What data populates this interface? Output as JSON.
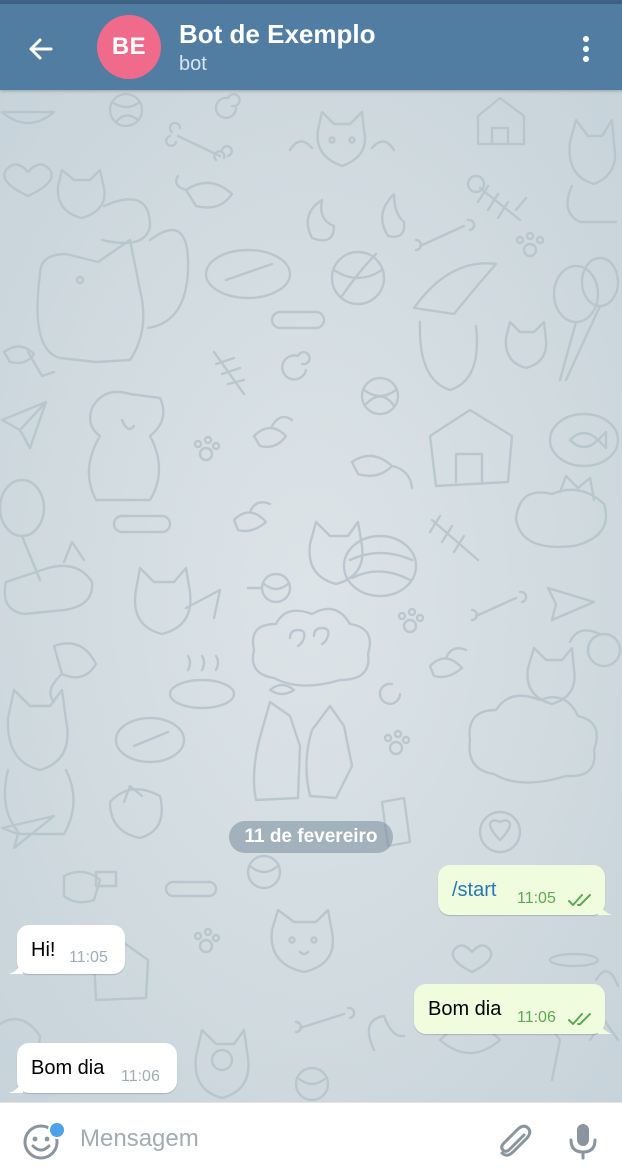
{
  "header": {
    "avatar_initials": "BE",
    "avatar_color": "#f06a8c",
    "title": "Bot de Exemplo",
    "subtitle": "bot",
    "back_icon": "arrow-left-icon",
    "menu_icon": "more-vertical-icon",
    "bar_color": "#517da2"
  },
  "date_separator": "11 de fevereiro",
  "messages": [
    {
      "direction": "outgoing",
      "text": "/start",
      "time": "11:05",
      "status": "read",
      "is_command": true
    },
    {
      "direction": "incoming",
      "text": "Hi!",
      "time": "11:05"
    },
    {
      "direction": "outgoing",
      "text": "Bom dia",
      "time": "11:06",
      "status": "read"
    },
    {
      "direction": "incoming",
      "text": "Bom dia",
      "time": "11:06"
    }
  ],
  "composer": {
    "placeholder": "Mensagem",
    "emoji_icon": "smile-icon",
    "attach_icon": "paperclip-icon",
    "mic_icon": "microphone-icon"
  },
  "colors": {
    "outgoing_bubble": "#effdde",
    "incoming_bubble": "#ffffff",
    "read_ticks": "#5ea853",
    "command_link": "#2678b6"
  }
}
